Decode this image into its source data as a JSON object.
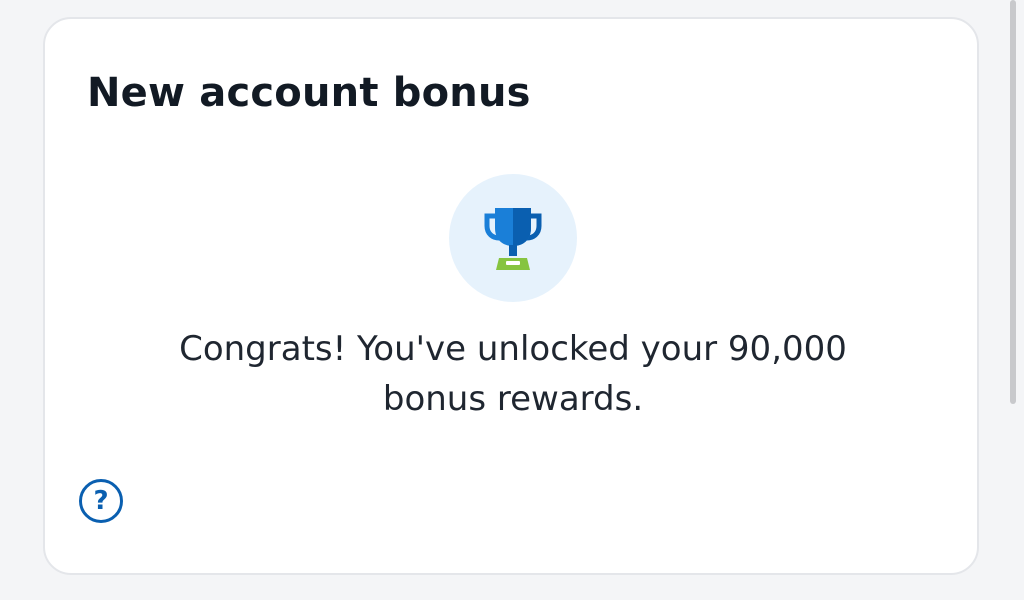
{
  "card": {
    "title": "New account bonus",
    "message": "Congrats! You've unlocked your 90,000 bonus rewards.",
    "help_label": "?"
  },
  "icons": {
    "trophy": "trophy-icon",
    "help": "question-circle-icon"
  },
  "colors": {
    "page_background": "#f4f5f7",
    "card_background": "#ffffff",
    "trophy_blue": "#1a7fd8",
    "trophy_dark_blue": "#0a5fb0",
    "trophy_base_green": "#86c440",
    "badge_background": "#e6f2fc",
    "help_icon": "#0a5fb0",
    "title_text": "#121a24"
  }
}
